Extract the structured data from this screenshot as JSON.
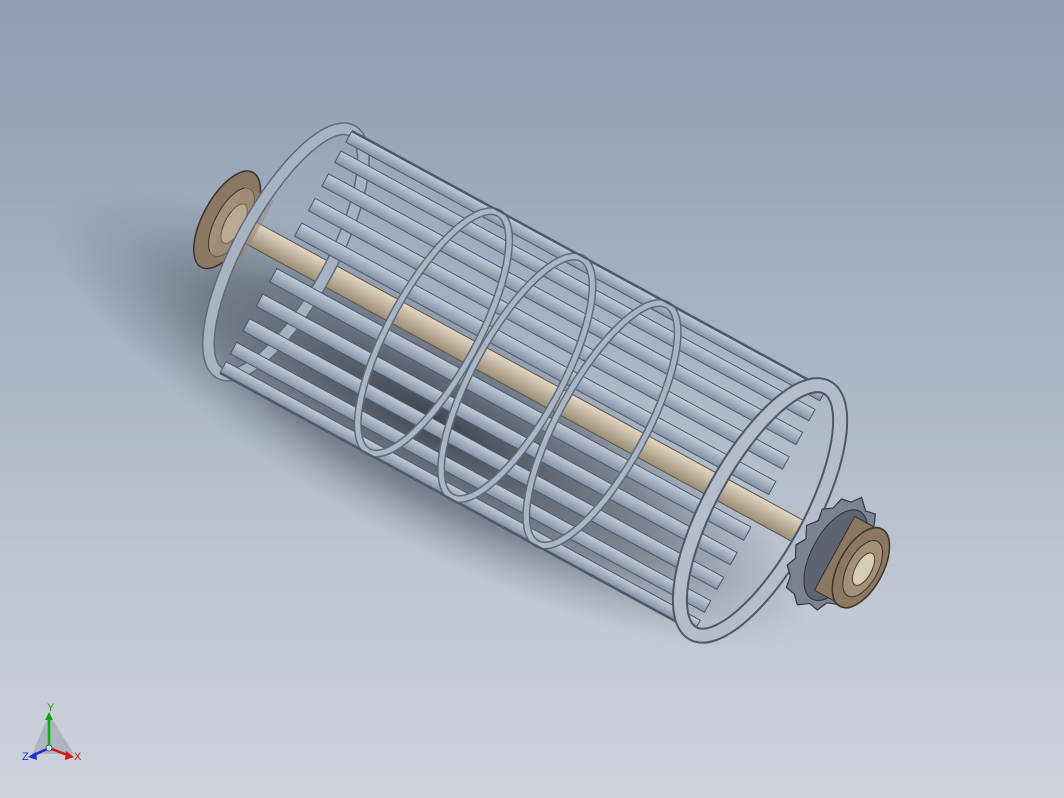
{
  "viewport": {
    "background_top": "#8d9db4",
    "background_bottom": "#cfd3da"
  },
  "model": {
    "parts": [
      "cage-drum",
      "shaft",
      "left-bearing",
      "right-bearing",
      "sprocket"
    ],
    "colors": {
      "cage": "#a7b2c3",
      "cage_dark": "#5f6a7a",
      "shaft": "#cdbfa6",
      "bearing": "#8b7762",
      "sprocket": "#7b8391"
    }
  },
  "triad": {
    "y_label": "Y",
    "x_label": "X",
    "z_label": "Z",
    "colors": {
      "x": "#d01616",
      "y": "#16a416",
      "z": "#1a2fd0"
    }
  }
}
